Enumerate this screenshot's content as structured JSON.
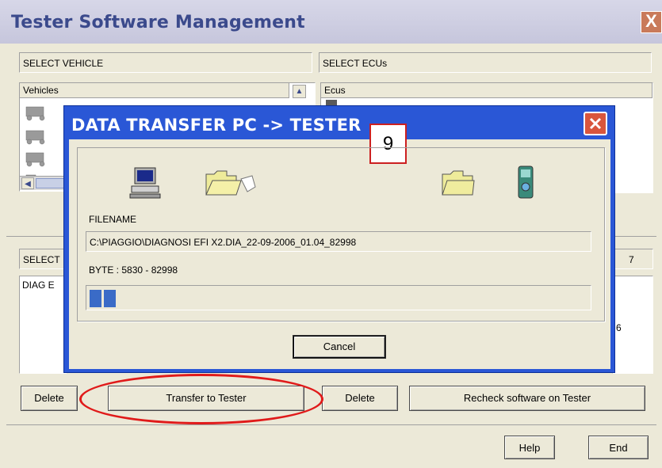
{
  "window": {
    "title": "Tester Software Management",
    "close_glyph": "X"
  },
  "vehicle_section": {
    "label": "SELECT VEHICLE",
    "column_header": "Vehicles",
    "scroll_up": "▲",
    "scroll_left": "◀"
  },
  "ecu_section": {
    "label": "SELECT ECUs",
    "column_header": "Ecus"
  },
  "software_section": {
    "label_visible": "SELECT",
    "right_count": "7",
    "list_item_visible": "DIAG E",
    "right_partial": "6"
  },
  "bottom_buttons": {
    "delete_left": "Delete",
    "transfer": "Transfer to Tester",
    "delete_right": "Delete",
    "recheck": "Recheck software on Tester",
    "help": "Help",
    "end": "End"
  },
  "dialog": {
    "title": "DATA TRANSFER PC -> TESTER",
    "callout_number": "9",
    "filename_label": "FILENAME",
    "filename_value": "C:\\PIAGGIO\\DIAGNOSI EFI X2.DIA_22-09-2006_01.04_82998",
    "byte_label": "BYTE : 5830 - 82998",
    "progress_fraction": 0.07,
    "cancel": "Cancel",
    "icons": [
      "computer-icon",
      "folder-open-icon",
      "folder-icon",
      "tester-device-icon"
    ]
  },
  "colors": {
    "dialog_title_bar": "#2a57d6",
    "close_button": "#d9553c",
    "progress": "#3a6bc7",
    "highlight_ellipse": "#e01a1a",
    "main_title": "#3b4a8c"
  }
}
